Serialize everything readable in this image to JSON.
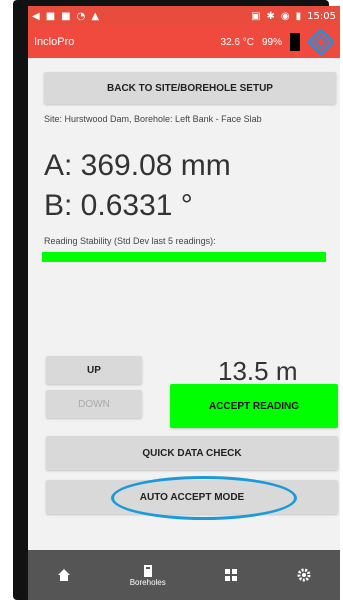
{
  "statusbar": {
    "time": "15:05"
  },
  "appbar": {
    "title": "IncloPro",
    "temperature": "32.6 °C",
    "battery_percent": "99%"
  },
  "buttons": {
    "back": "BACK TO SITE/BOREHOLE SETUP",
    "up": "UP",
    "down": "DOWN",
    "accept": "ACCEPT READING",
    "quick": "QUICK DATA CHECK",
    "auto": "AUTO ACCEPT MODE"
  },
  "site_info": "Site: Hurstwood Dam, Borehole: Left Bank - Face Slab",
  "readings": {
    "a": "A:  369.08 mm",
    "b": "B:  0.6331 °"
  },
  "stability_label": "Reading Stability (Std Dev last 5 readings):",
  "depth": "13.5 m",
  "nav": {
    "boreholes_label": "Boreholes"
  },
  "colors": {
    "appbar": "#f04a3e",
    "stability_bar": "#00ff00",
    "accept_button": "#00ff00",
    "highlight_ring": "#1a9ad9",
    "navbar": "#555555"
  }
}
